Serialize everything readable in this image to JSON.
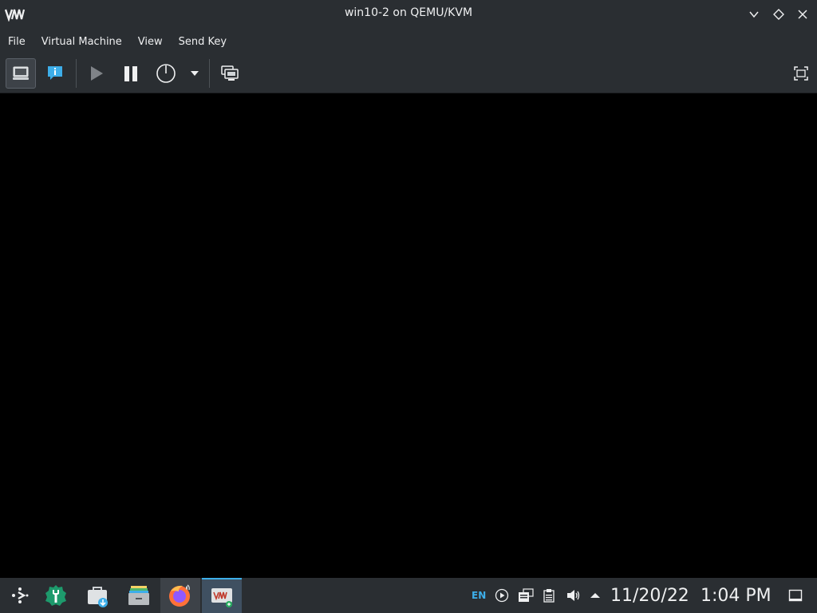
{
  "window": {
    "title": "win10-2 on QEMU/KVM",
    "logo_text": "VM"
  },
  "menu": {
    "items": [
      "File",
      "Virtual Machine",
      "View",
      "Send Key"
    ]
  },
  "toolbar": {
    "buttons": [
      {
        "name": "console-button",
        "icon": "monitor-icon",
        "active": true
      },
      {
        "name": "details-button",
        "icon": "info-bubble-icon",
        "active": false
      },
      {
        "name": "run-button",
        "icon": "play-icon",
        "active": false
      },
      {
        "name": "pause-button",
        "icon": "pause-icon",
        "active": false
      },
      {
        "name": "shutdown-button",
        "icon": "power-icon",
        "active": false
      },
      {
        "name": "shutdown-menu-button",
        "icon": "dropdown-arrow-icon",
        "active": false
      },
      {
        "name": "snapshots-button",
        "icon": "snapshots-icon",
        "active": false
      },
      {
        "name": "fullscreen-button",
        "icon": "fullscreen-icon",
        "active": false
      }
    ]
  },
  "taskbar": {
    "apps": [
      {
        "name": "application-launcher",
        "icon": "kde-launcher-icon"
      },
      {
        "name": "system-settings",
        "icon": "settings-wrench-icon"
      },
      {
        "name": "discover",
        "icon": "discover-bag-icon"
      },
      {
        "name": "dolphin-files",
        "icon": "file-manager-icon"
      },
      {
        "name": "firefox",
        "icon": "firefox-icon"
      },
      {
        "name": "virt-manager",
        "icon": "virt-manager-icon"
      }
    ],
    "tray": {
      "language": "EN",
      "date": "11/20/22",
      "time": "1:04 PM"
    }
  },
  "colors": {
    "titlebar_bg": "#2a2e32",
    "accent": "#3daee9",
    "vm_display_bg": "#000000",
    "text": "#eff0f1"
  }
}
